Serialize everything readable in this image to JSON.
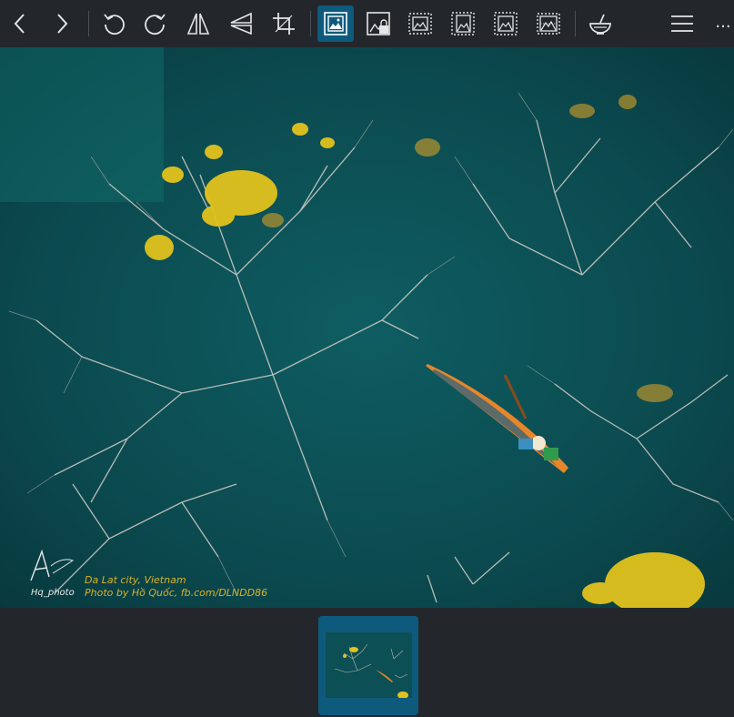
{
  "toolbar": {
    "buttons": [
      {
        "name": "previous-button",
        "icon": "chevron-left-icon"
      },
      {
        "name": "next-button",
        "icon": "chevron-right-icon"
      },
      {
        "name": "rotate-left-button",
        "icon": "rotate-ccw-icon"
      },
      {
        "name": "rotate-right-button",
        "icon": "rotate-cw-icon"
      },
      {
        "name": "flip-horizontal-button",
        "icon": "flip-horizontal-icon"
      },
      {
        "name": "flip-vertical-button",
        "icon": "flip-vertical-icon"
      },
      {
        "name": "crop-button",
        "icon": "crop-icon"
      },
      {
        "name": "fit-to-window-button",
        "icon": "image-fit-icon",
        "active": true
      },
      {
        "name": "lock-zoom-button",
        "icon": "image-lock-icon"
      },
      {
        "name": "zoom-mode-1-button",
        "icon": "image-dashed-icon"
      },
      {
        "name": "zoom-mode-2-button",
        "icon": "image-dashed-icon"
      },
      {
        "name": "zoom-mode-3-button",
        "icon": "image-dashed-icon"
      },
      {
        "name": "zoom-mode-4-button",
        "icon": "image-dashed-icon"
      },
      {
        "name": "clean-button",
        "icon": "bowl-icon"
      },
      {
        "name": "menu-button",
        "icon": "hamburger-icon"
      }
    ],
    "more_label": "..."
  },
  "photo": {
    "caption_line1": "Da Lat city, Vietnam",
    "caption_line2": "Photo by Hồ Quốc, fb.com/DLNDD86",
    "signature": "Hq_photo"
  },
  "colors": {
    "background": "#23272c",
    "accent": "#0e5a7c",
    "caption": "#d9b22b",
    "water": "#0b4d52"
  }
}
